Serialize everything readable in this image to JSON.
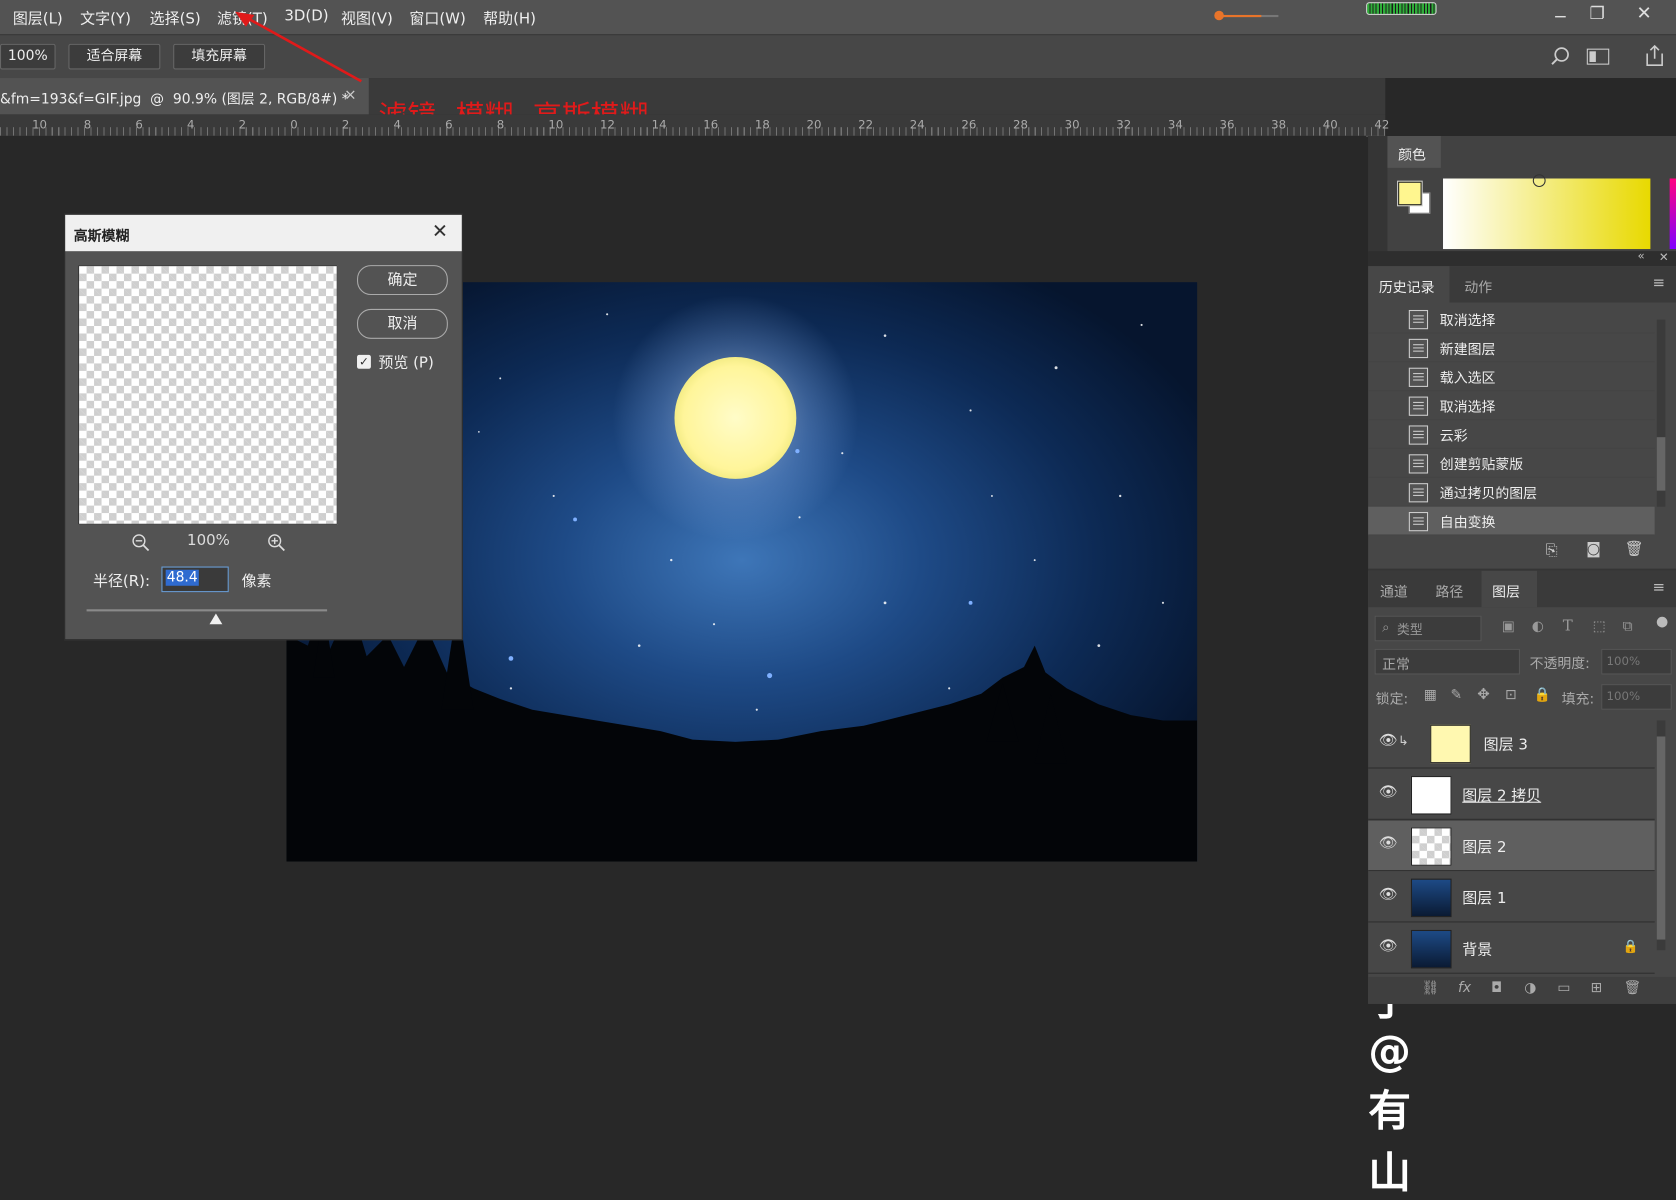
{
  "menu": [
    "图层(L)",
    "文字(Y)",
    "选择(S)",
    "滤镜(T)",
    "3D(D)",
    "视图(V)",
    "窗口(W)",
    "帮助(H)"
  ],
  "options": {
    "zoom": "100%",
    "fit_screen": "适合屏幕",
    "fill_screen": "填充屏幕"
  },
  "document_tab": {
    "title": "&fm=193&f=GIF.jpg  @  90.9% (图层 2, RGB/8#) *",
    "close": "×"
  },
  "annotation": "滤镜--模糊--高斯模糊",
  "ruler_ticks": [
    "10",
    "8",
    "6",
    "4",
    "2",
    "0",
    "2",
    "4",
    "6",
    "8",
    "10",
    "12",
    "14",
    "16",
    "18",
    "20",
    "22",
    "24",
    "26",
    "28",
    "30",
    "32",
    "34",
    "36",
    "38",
    "40",
    "42"
  ],
  "dialog": {
    "title": "高斯模糊",
    "ok_label": "确定",
    "cancel_label": "取消",
    "preview_label": "预览 (P)",
    "preview_checked": true,
    "zoom_level": "100%",
    "radius_label": "半径(R):",
    "radius_value": "48.4",
    "unit": "像素"
  },
  "color_panel": {
    "tab": "颜色",
    "foreground": "#fff68f",
    "background": "#ffffff"
  },
  "history_panel": {
    "tabs": [
      "历史记录",
      "动作"
    ],
    "items": [
      "取消选择",
      "新建图层",
      "载入选区",
      "取消选择",
      "云彩",
      "创建剪贴蒙版",
      "通过拷贝的图层",
      "自由变换"
    ],
    "selected_index": 7
  },
  "layers_panel": {
    "tabs": [
      "通道",
      "路径",
      "图层"
    ],
    "active_tab": "图层",
    "filter_placeholder": "类型",
    "blend_mode": "正常",
    "opacity_label": "不透明度:",
    "opacity_value": "100%",
    "lock_label": "锁定:",
    "fill_label": "填充:",
    "fill_value": "100%",
    "layers": [
      {
        "name": "图层 3"
      },
      {
        "name": "图层 2 拷贝"
      },
      {
        "name": "图层 2"
      },
      {
        "name": "图层 1"
      },
      {
        "name": "背景"
      }
    ]
  },
  "watermark": "知乎 @有山"
}
